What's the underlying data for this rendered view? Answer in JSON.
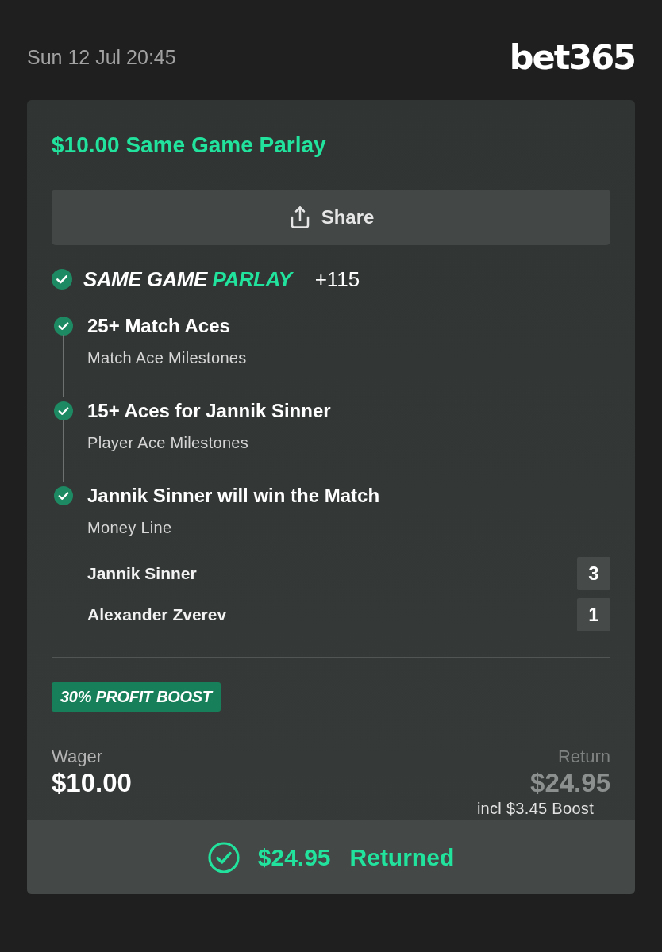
{
  "header": {
    "datetime": "Sun 12 Jul 20:45",
    "logo": "bet365"
  },
  "bet": {
    "title": "$10.00 Same Game Parlay",
    "share_button": "Share",
    "parlay": {
      "won": true,
      "label_main": "SAME GAME",
      "label_accent": "PARLAY",
      "odds": "+115"
    },
    "legs": [
      {
        "title": "25+ Match Aces",
        "market": "Match Ace Milestones",
        "won": true
      },
      {
        "title": "15+ Aces for Jannik Sinner",
        "market": "Player Ace Milestones",
        "won": true
      },
      {
        "title": "Jannik Sinner will win the Match",
        "market": "Money Line",
        "won": true
      }
    ],
    "scores": [
      {
        "player": "Jannik Sinner",
        "score": "3"
      },
      {
        "player": "Alexander Zverev",
        "score": "1"
      }
    ],
    "boost_badge": "30% PROFIT BOOST",
    "wager": {
      "label": "Wager",
      "amount": "$10.00"
    },
    "return": {
      "label": "Return",
      "amount": "$24.95",
      "note": "incl $3.45 Boost"
    },
    "result": {
      "amount": "$24.95",
      "status": "Returned"
    }
  }
}
